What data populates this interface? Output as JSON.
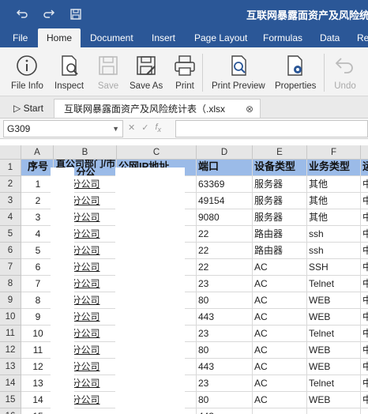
{
  "window": {
    "title": "互联网暴露面资产及风险统计"
  },
  "menu": [
    "File",
    "Home",
    "Document",
    "Insert",
    "Page Layout",
    "Formulas",
    "Data",
    "Re"
  ],
  "ribbon": {
    "file_info": "File Info",
    "inspect": "Inspect",
    "save": "Save",
    "save_as": "Save As",
    "print": "Print",
    "print_preview": "Print Preview",
    "properties": "Properties",
    "undo": "Undo"
  },
  "tabs": {
    "start": "Start",
    "file": "互联网暴露面资产及风险统计表（.xlsx"
  },
  "formula_bar": {
    "cell_ref": "G309",
    "content": ""
  },
  "sheet": {
    "columns": [
      "A",
      "B",
      "C",
      "D",
      "E",
      "F",
      "G"
    ],
    "row_numbers": [
      "1",
      "2",
      "3",
      "4",
      "5",
      "6",
      "7",
      "8",
      "9",
      "10",
      "11",
      "12",
      "13",
      "14",
      "15",
      "16"
    ],
    "headers": [
      "序号",
      "直公司部门/市分公",
      "公网IP地址",
      "端口",
      "设备类型",
      "业务类型",
      "运"
    ],
    "rows": [
      [
        "1",
        "分公司",
        "",
        "63369",
        "服务器",
        "其他",
        "中"
      ],
      [
        "2",
        "分公司",
        "",
        "49154",
        "服务器",
        "其他",
        "中"
      ],
      [
        "3",
        "分公司",
        "",
        "9080",
        "服务器",
        "其他",
        "中"
      ],
      [
        "4",
        "分公司",
        "",
        "22",
        "路由器",
        "ssh",
        "中"
      ],
      [
        "5",
        "分公司",
        "",
        "22",
        "路由器",
        "ssh",
        "中"
      ],
      [
        "6",
        "分公司",
        "",
        "22",
        "AC",
        "SSH",
        "中"
      ],
      [
        "7",
        "分公司",
        "",
        "23",
        "AC",
        "Telnet",
        "中"
      ],
      [
        "8",
        "分公司",
        "",
        "80",
        "AC",
        "WEB",
        "中"
      ],
      [
        "9",
        "分公司",
        "",
        "443",
        "AC",
        "WEB",
        "中"
      ],
      [
        "10",
        "分公司",
        "",
        "23",
        "AC",
        "Telnet",
        "中"
      ],
      [
        "11",
        "分公司",
        "",
        "80",
        "AC",
        "WEB",
        "中"
      ],
      [
        "12",
        "分公司",
        "",
        "443",
        "AC",
        "WEB",
        "中"
      ],
      [
        "13",
        "分公司",
        "",
        "23",
        "AC",
        "Telnet",
        "中"
      ],
      [
        "14",
        "分公司",
        "",
        "80",
        "AC",
        "WEB",
        "中"
      ],
      [
        "15",
        "",
        "",
        "443",
        "",
        "",
        ""
      ]
    ]
  },
  "colors": {
    "titlebar": "#2b5797",
    "header_fill": "#9bbbe8"
  }
}
